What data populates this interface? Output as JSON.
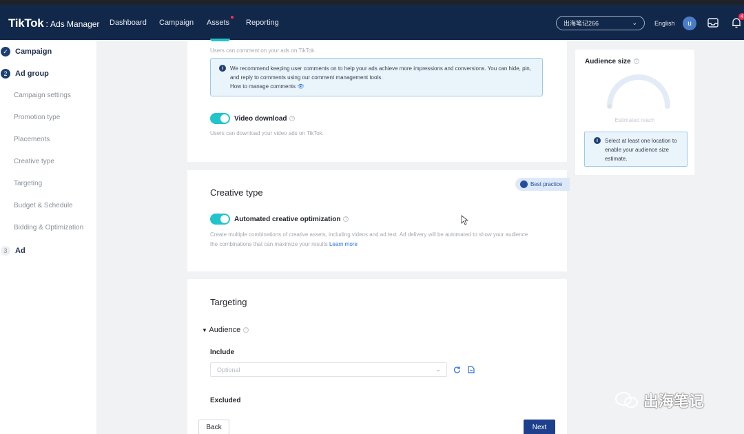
{
  "header": {
    "logo": "TikTok",
    "logo_separator": ":",
    "logo_sub": "Ads Manager",
    "nav": [
      "Dashboard",
      "Campaign",
      "Assets",
      "Reporting"
    ],
    "account": "出海笔记266",
    "language": "English",
    "avatar_letter": "u",
    "notification_count": "4"
  },
  "sidebar": {
    "steps": [
      {
        "label": "Campaign",
        "marker": "✓"
      },
      {
        "label": "Ad group",
        "marker": "2"
      },
      {
        "label": "Ad",
        "marker": "3"
      }
    ],
    "adgroup_items": [
      "Campaign settings",
      "Promotion type",
      "Placements",
      "Creative type",
      "Targeting",
      "Budget & Schedule",
      "Bidding & Optimization"
    ]
  },
  "comments": {
    "description": "Users can comment on your ads on TikTok.",
    "info_text": "We recommend keeping user comments on to help your ads achieve more impressions and conversions. You can hide, pin, and reply to comments using our comment management tools.",
    "info_link": "How to manage comments"
  },
  "video_download": {
    "label": "Video download",
    "description": "Users can download your video ads on TikTok."
  },
  "creative_type": {
    "title": "Creative type",
    "toggle_label": "Automated creative optimization",
    "description": "Create multiple combinations of creative assets, including videos and ad text. Ad delivery will be automated to show your audience the combinations that can maximize your results",
    "learn_more": "Learn more",
    "best_practice": "Best practice"
  },
  "targeting": {
    "title": "Targeting",
    "audience_label": "Audience",
    "include_label": "Include",
    "include_placeholder": "Optional",
    "exclude_label": "Excluded"
  },
  "audience_size": {
    "title": "Audience size",
    "gauge_label": "Estimated reach",
    "info_text": "Select at least one location to enable your audience size estimate."
  },
  "footer": {
    "back": "Back",
    "next": "Next"
  },
  "watermark": "出海笔记",
  "colors": {
    "nav_bg": "#12284a",
    "toggle_on": "#20c4cb",
    "primary_button": "#1d3f8c",
    "info_bg": "#eaf4fb"
  }
}
